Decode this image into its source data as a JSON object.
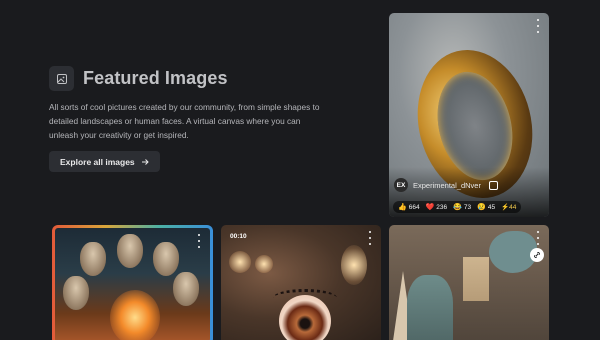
{
  "hero": {
    "title": "Featured Images",
    "description": "All sorts of cool pictures created by our community, from simple shapes to detailed landscapes or human faces. A virtual canvas where you can unleash your creativity or get inspired.",
    "button_label": "Explore all images"
  },
  "cards": {
    "ring": {
      "user_initials": "EX",
      "username": "Experimental_dNver",
      "reactions": [
        {
          "icon": "thumbs-up-icon",
          "emoji": "👍",
          "count": "664"
        },
        {
          "icon": "heart-icon",
          "emoji": "❤️",
          "count": "236"
        },
        {
          "icon": "laugh-icon",
          "emoji": "😂",
          "count": "73"
        },
        {
          "icon": "cry-icon",
          "emoji": "😢",
          "count": "45"
        }
      ],
      "tip": "⚡44"
    },
    "eye": {
      "time": "00:10"
    }
  },
  "colors": {
    "background": "#1a1b1e",
    "button": "#2c2e33",
    "text": "#c1c2c5"
  }
}
